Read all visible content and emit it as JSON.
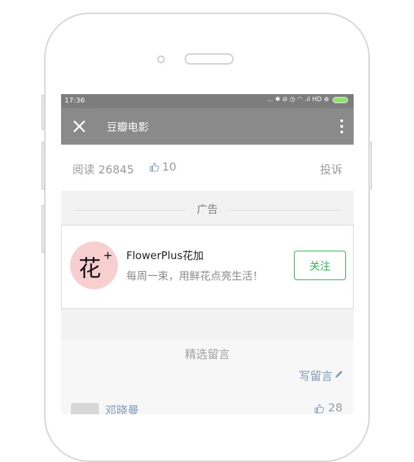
{
  "status_bar": {
    "time": "17:36",
    "indicators": "... ✱ ⊘ ◷ ◠ .ıl HD ⊕"
  },
  "nav": {
    "title": "豆瓣电影",
    "close_icon": "close-icon",
    "more_icon": "more-icon"
  },
  "stats": {
    "read": "阅读 26845",
    "likes": "10",
    "report": "投诉"
  },
  "ad": {
    "section_label": "广告",
    "logo_text": "花",
    "logo_plus": "+",
    "name": "FlowerPlus花加",
    "description": "每周一束，用鲜花点亮生活！",
    "follow_label": "关注",
    "accent_color": "#2fb454"
  },
  "comments": {
    "heading": "精选留言",
    "write_label": "写留言",
    "items": [
      {
        "name": "邓晓曼",
        "likes": "28"
      }
    ]
  }
}
